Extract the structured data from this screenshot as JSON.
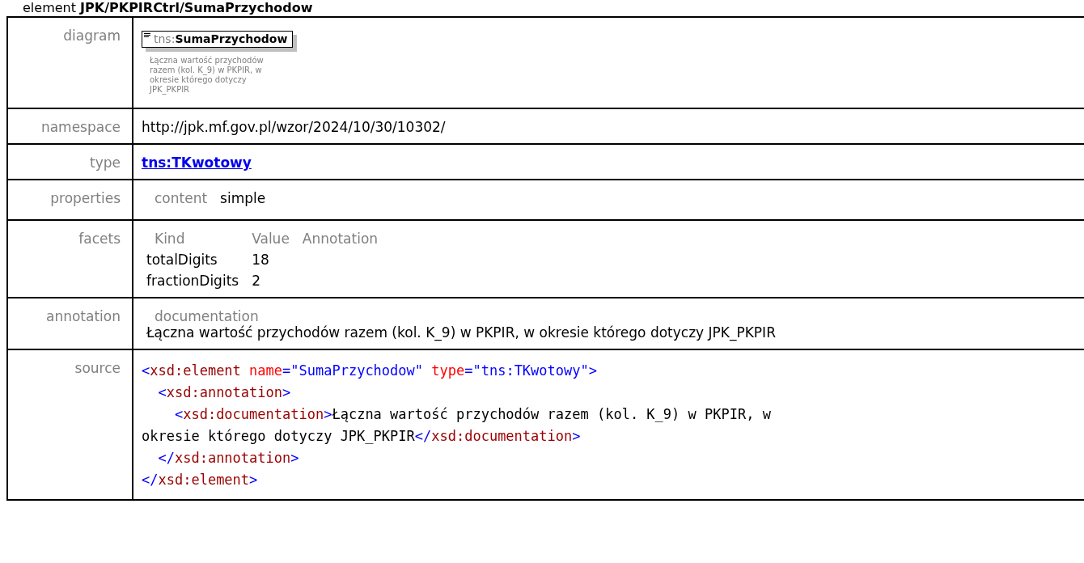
{
  "heading": {
    "prefix": "element",
    "path": "JPK/PKPIRCtrl/SumaPrzychodow"
  },
  "diagram": {
    "label": "diagram",
    "prefix": "tns:",
    "name": "SumaPrzychodow",
    "description": "Łączna wartość przychodów razem (kol. K_9) w PKPIR, w okresie którego dotyczy JPK_PKPIR"
  },
  "namespace": {
    "label": "namespace",
    "value": "http://jpk.mf.gov.pl/wzor/2024/10/30/10302/"
  },
  "type": {
    "label": "type",
    "link": "tns:TKwotowy"
  },
  "properties": {
    "label": "properties",
    "key": "content",
    "value": "simple"
  },
  "facets": {
    "label": "facets",
    "columns": [
      "Kind",
      "Value",
      "Annotation"
    ],
    "rows": [
      {
        "kind": "totalDigits",
        "value": "18"
      },
      {
        "kind": "fractionDigits",
        "value": "2"
      }
    ]
  },
  "annotation": {
    "label": "annotation",
    "key": "documentation",
    "text": "Łączna wartość przychodów razem (kol. K_9) w PKPIR, w okresie którego dotyczy JPK_PKPIR"
  },
  "source": {
    "label": "source",
    "lines": [
      [
        {
          "kind": "punct",
          "text": "<"
        },
        {
          "kind": "tag",
          "text": "xsd:element"
        },
        {
          "kind": "attr",
          "text": " name"
        },
        {
          "kind": "punct",
          "text": "=\"SumaPrzychodow\""
        },
        {
          "kind": "attr",
          "text": " type"
        },
        {
          "kind": "punct",
          "text": "=\"tns:TKwotowy\">"
        }
      ],
      [
        {
          "kind": "punct",
          "text": "  <"
        },
        {
          "kind": "tag",
          "text": "xsd:annotation"
        },
        {
          "kind": "punct",
          "text": ">"
        }
      ],
      [
        {
          "kind": "punct",
          "text": "    <"
        },
        {
          "kind": "tag",
          "text": "xsd:documentation"
        },
        {
          "kind": "punct",
          "text": ">"
        },
        {
          "kind": "text",
          "text": "Łączna wartość przychodów razem (kol. K_9) w PKPIR, w"
        }
      ],
      [
        {
          "kind": "text",
          "text": "okresie którego dotyczy JPK_PKPIR"
        },
        {
          "kind": "punct",
          "text": "</"
        },
        {
          "kind": "tag",
          "text": "xsd:documentation"
        },
        {
          "kind": "punct",
          "text": ">"
        }
      ],
      [
        {
          "kind": "punct",
          "text": "  </"
        },
        {
          "kind": "tag",
          "text": "xsd:annotation"
        },
        {
          "kind": "punct",
          "text": ">"
        }
      ],
      [
        {
          "kind": "punct",
          "text": "</"
        },
        {
          "kind": "tag",
          "text": "xsd:element"
        },
        {
          "kind": "punct",
          "text": ">"
        }
      ]
    ]
  }
}
